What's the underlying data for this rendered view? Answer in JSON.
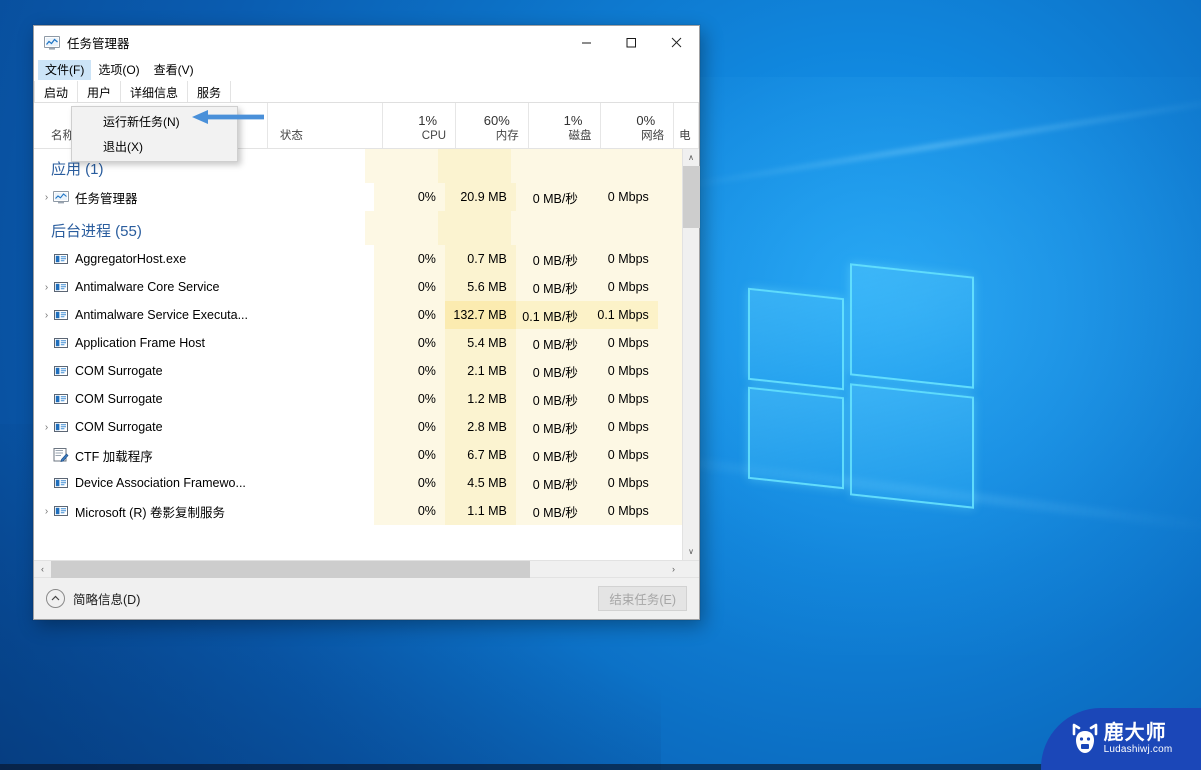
{
  "window": {
    "title": "任务管理器",
    "icon": "task-manager-icon",
    "minimize": "–",
    "maximize": "☐",
    "close": "✕"
  },
  "menubar": {
    "items": [
      {
        "label": "文件(F)",
        "open": true
      },
      {
        "label": "选项(O)",
        "open": false
      },
      {
        "label": "查看(V)",
        "open": false
      }
    ]
  },
  "file_menu": {
    "items": [
      {
        "label": "运行新任务(N)"
      },
      {
        "label": "退出(X)"
      }
    ]
  },
  "tabs": [
    {
      "label": "启动",
      "partial": true
    },
    {
      "label": "用户"
    },
    {
      "label": "详细信息"
    },
    {
      "label": "服务"
    }
  ],
  "columns": [
    {
      "key": "name",
      "label": "名称",
      "pct": ""
    },
    {
      "key": "state",
      "label": "状态",
      "pct": ""
    },
    {
      "key": "cpu",
      "label": "CPU",
      "pct": "1%"
    },
    {
      "key": "mem",
      "label": "内存",
      "pct": "60%"
    },
    {
      "key": "disk",
      "label": "磁盘",
      "pct": "1%"
    },
    {
      "key": "net",
      "label": "网络",
      "pct": "0%"
    },
    {
      "key": "power",
      "label": "电",
      "pct": ""
    }
  ],
  "groups": [
    {
      "title": "应用 (1)",
      "rows": [
        {
          "name": "任务管理器",
          "icon": "task-manager-icon",
          "expandable": true,
          "state": "",
          "cpu": "0%",
          "mem": "20.9 MB",
          "disk": "0 MB/秒",
          "net": "0 Mbps",
          "hot": false
        }
      ]
    },
    {
      "title": "后台进程 (55)",
      "rows": [
        {
          "name": "AggregatorHost.exe",
          "icon": "process-icon",
          "expandable": false,
          "state": "",
          "cpu": "0%",
          "mem": "0.7 MB",
          "disk": "0 MB/秒",
          "net": "0 Mbps",
          "hot": false
        },
        {
          "name": "Antimalware Core Service",
          "icon": "process-icon",
          "expandable": true,
          "state": "",
          "cpu": "0%",
          "mem": "5.6 MB",
          "disk": "0 MB/秒",
          "net": "0 Mbps",
          "hot": false
        },
        {
          "name": "Antimalware Service Executa...",
          "icon": "process-icon",
          "expandable": true,
          "state": "",
          "cpu": "0%",
          "mem": "132.7 MB",
          "disk": "0.1 MB/秒",
          "net": "0.1 Mbps",
          "hot": true
        },
        {
          "name": "Application Frame Host",
          "icon": "process-icon",
          "expandable": false,
          "state": "",
          "cpu": "0%",
          "mem": "5.4 MB",
          "disk": "0 MB/秒",
          "net": "0 Mbps",
          "hot": false
        },
        {
          "name": "COM Surrogate",
          "icon": "process-icon",
          "expandable": false,
          "state": "",
          "cpu": "0%",
          "mem": "2.1 MB",
          "disk": "0 MB/秒",
          "net": "0 Mbps",
          "hot": false
        },
        {
          "name": "COM Surrogate",
          "icon": "process-icon",
          "expandable": false,
          "state": "",
          "cpu": "0%",
          "mem": "1.2 MB",
          "disk": "0 MB/秒",
          "net": "0 Mbps",
          "hot": false
        },
        {
          "name": "COM Surrogate",
          "icon": "process-icon",
          "expandable": true,
          "state": "",
          "cpu": "0%",
          "mem": "2.8 MB",
          "disk": "0 MB/秒",
          "net": "0 Mbps",
          "hot": false
        },
        {
          "name": "CTF 加载程序",
          "icon": "ctf-loader-icon",
          "expandable": false,
          "state": "",
          "cpu": "0%",
          "mem": "6.7 MB",
          "disk": "0 MB/秒",
          "net": "0 Mbps",
          "hot": false
        },
        {
          "name": "Device Association Framewo...",
          "icon": "process-icon",
          "expandable": false,
          "state": "",
          "cpu": "0%",
          "mem": "4.5 MB",
          "disk": "0 MB/秒",
          "net": "0 Mbps",
          "hot": false
        },
        {
          "name": "Microsoft (R) 卷影复制服务",
          "icon": "process-icon",
          "expandable": true,
          "state": "",
          "cpu": "0%",
          "mem": "1.1 MB",
          "disk": "0 MB/秒",
          "net": "0 Mbps",
          "hot": false
        }
      ]
    }
  ],
  "footer": {
    "less_details": "简略信息(D)",
    "less_icon": "chevron-up-icon",
    "end_task": "结束任务(E)",
    "end_task_enabled": false
  },
  "scrollbars": {
    "up_arrow": "∧",
    "down_arrow": "∨",
    "left_arrow": "‹",
    "right_arrow": "›"
  },
  "annotation": {
    "arrow": "left-arrow-annotation",
    "color": "#4a90d9"
  },
  "watermark": {
    "cn": "鹿大师",
    "en": "Ludashiwj.com",
    "bg": "#1b47b8"
  }
}
